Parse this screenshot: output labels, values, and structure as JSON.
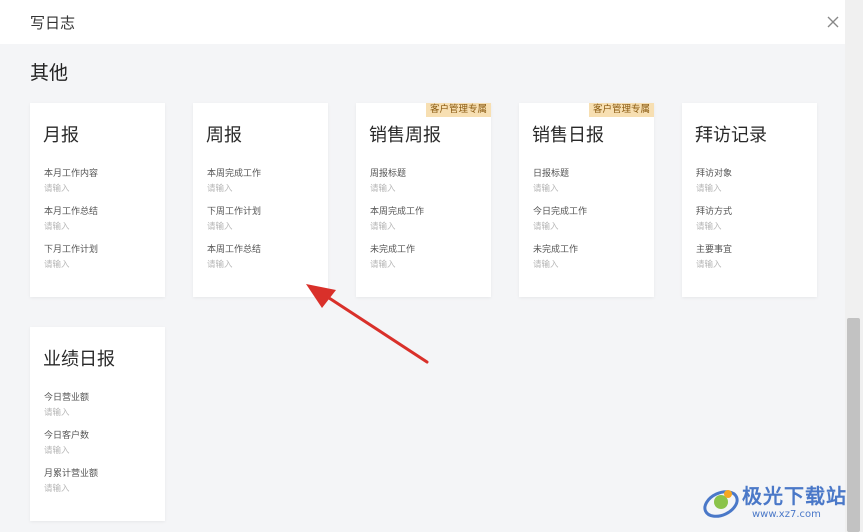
{
  "dialog": {
    "title": "写日志",
    "close_icon": "close-icon"
  },
  "section": {
    "title": "其他"
  },
  "cards": [
    {
      "title": "月报",
      "tag": "",
      "fields": [
        {
          "label": "本月工作内容",
          "placeholder": "请输入"
        },
        {
          "label": "本月工作总结",
          "placeholder": "请输入"
        },
        {
          "label": "下月工作计划",
          "placeholder": "请输入"
        }
      ]
    },
    {
      "title": "周报",
      "tag": "",
      "fields": [
        {
          "label": "本周完成工作",
          "placeholder": "请输入"
        },
        {
          "label": "下周工作计划",
          "placeholder": "请输入"
        },
        {
          "label": "本周工作总结",
          "placeholder": "请输入"
        }
      ]
    },
    {
      "title": "销售周报",
      "tag": "客户管理专属",
      "fields": [
        {
          "label": "周报标题",
          "placeholder": "请输入"
        },
        {
          "label": "本周完成工作",
          "placeholder": "请输入"
        },
        {
          "label": "未完成工作",
          "placeholder": "请输入"
        }
      ]
    },
    {
      "title": "销售日报",
      "tag": "客户管理专属",
      "fields": [
        {
          "label": "日报标题",
          "placeholder": "请输入"
        },
        {
          "label": "今日完成工作",
          "placeholder": "请输入"
        },
        {
          "label": "未完成工作",
          "placeholder": "请输入"
        }
      ]
    },
    {
      "title": "拜访记录",
      "tag": "",
      "fields": [
        {
          "label": "拜访对象",
          "placeholder": "请输入"
        },
        {
          "label": "拜访方式",
          "placeholder": "请输入"
        },
        {
          "label": "主要事宜",
          "placeholder": "请输入"
        }
      ]
    },
    {
      "title": "业绩日报",
      "tag": "",
      "fields": [
        {
          "label": "今日营业额",
          "placeholder": "请输入"
        },
        {
          "label": "今日客户数",
          "placeholder": "请输入"
        },
        {
          "label": "月累计营业额",
          "placeholder": "请输入"
        }
      ]
    }
  ],
  "watermark": {
    "name": "极光下载站",
    "url": "www.xz7.com"
  },
  "colors": {
    "tag_bg": "#f7dfb2",
    "tag_text": "#8a5a10",
    "arrow": "#d9302a",
    "watermark": "#4a78c8"
  }
}
